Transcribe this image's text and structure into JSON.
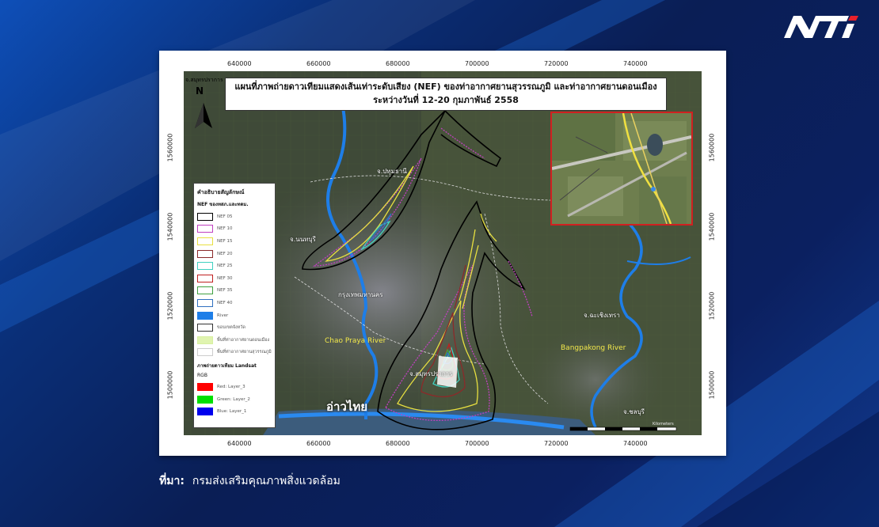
{
  "brand": {
    "logo_text": "NTi"
  },
  "map": {
    "title_line1": "แผนที่ภาพถ่ายดาวเทียมแสดงเส้นเท่าระดับเสียง (NEF) ของท่าอากาศยานสุวรรณภูมิ และท่าอากาศยานดอนเมือง",
    "title_line2": "ระหว่างวันที่ 12-20 กุมภาพันธ์ 2558",
    "x_ticks": [
      "640000",
      "660000",
      "680000",
      "700000",
      "720000",
      "740000"
    ],
    "y_ticks": [
      "1560000",
      "1540000",
      "1520000",
      "1500000"
    ],
    "places": {
      "samut_prakan_top": "จ.สมุทรปราการ",
      "pathum_thani": "จ.ปทุมธานี",
      "nonthaburi": "จ.นนทบุรี",
      "bangkok": "กรุงเทพมหานคร",
      "chachoengsao": "จ.ฉะเชิงเทรา",
      "samut_prakan": "จ.สมุทรปราการ",
      "chonburi": "จ.ชลบุรี",
      "gulf": "อ่าวไทย"
    },
    "rivers": {
      "chao_praya": "Chao Praya River",
      "bangpakong": "Bangpakong River"
    },
    "north_label": "N",
    "scale_label": "Kilometers"
  },
  "legend": {
    "title": "คำอธิบายสัญลักษณ์",
    "subtitle": "NEF ของทสภ.และทดม.",
    "items": [
      {
        "label": "NEF 05",
        "color": "#000000",
        "fill": "none"
      },
      {
        "label": "NEF 10",
        "color": "#c040c0",
        "fill": "none"
      },
      {
        "label": "NEF 15",
        "color": "#e8e040",
        "fill": "none"
      },
      {
        "label": "NEF 20",
        "color": "#8b2a2a",
        "fill": "none"
      },
      {
        "label": "NEF 25",
        "color": "#40d0c0",
        "fill": "none"
      },
      {
        "label": "NEF 30",
        "color": "#c02020",
        "fill": "none"
      },
      {
        "label": "NEF 35",
        "color": "#40a040",
        "fill": "none"
      },
      {
        "label": "NEF 40",
        "color": "#3070c0",
        "fill": "none"
      },
      {
        "label": "River",
        "color": "#1e7ee8",
        "fill": "#1e7ee8"
      },
      {
        "label": "ขอบเขตจังหวัด",
        "color": "#333333",
        "fill": "none"
      },
      {
        "label": "พื้นที่ท่าอากาศยานดอนเมือง",
        "color": "#d8f0a0",
        "fill": "#e0f4b0"
      },
      {
        "label": "พื้นที่ท่าอากาศยานสุวรรณภูมิ",
        "color": "#cccccc",
        "fill": "#ffffff"
      }
    ],
    "landsat_title": "ภาพถ่ายดาวเทียม Landsat",
    "rgb_title": "RGB",
    "bands": [
      {
        "label": "Red:  Layer_3",
        "color": "#ff0000"
      },
      {
        "label": "Green:  Layer_2",
        "color": "#00e000"
      },
      {
        "label": "Blue:  Layer_1",
        "color": "#0000ee"
      }
    ]
  },
  "source": {
    "label": "ที่มา:",
    "text": "กรมส่งเสริมคุณภาพสิ่งแวดล้อม"
  }
}
